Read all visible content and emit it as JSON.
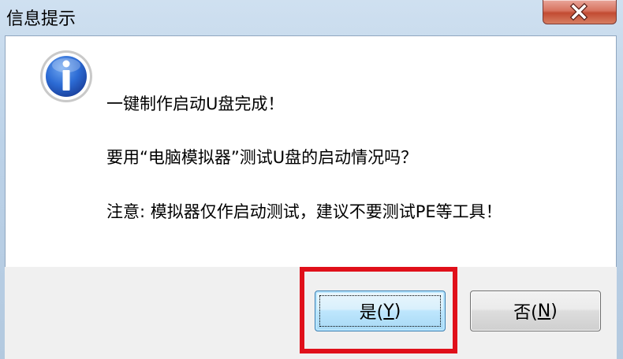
{
  "window": {
    "title": "信息提示",
    "close_icon": "close-icon",
    "info_icon": "info-icon"
  },
  "message": {
    "line1": "一键制作启动U盘完成！",
    "line2": "要用“电脑模拟器”测试U盘的启动情况吗？",
    "line3": "注意: 模拟器仅作启动测试，建议不要测试PE等工具！"
  },
  "buttons": {
    "yes_prefix": "是(",
    "yes_key": "Y",
    "yes_suffix": ")",
    "no_prefix": "否(",
    "no_key": "N",
    "no_suffix": ")"
  },
  "colors": {
    "highlight": "#e0101a",
    "accent": "#3c7fb1"
  }
}
